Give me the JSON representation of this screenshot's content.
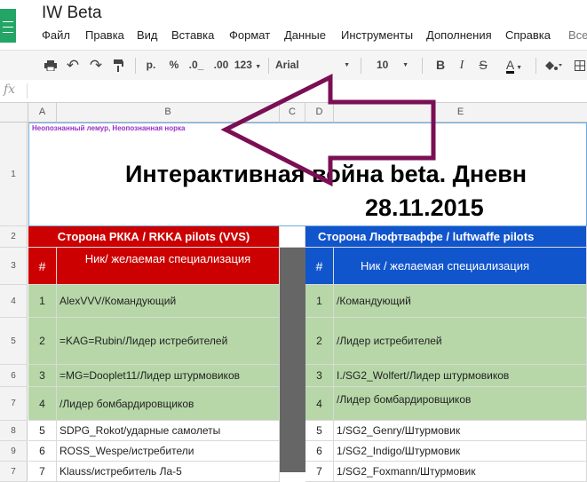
{
  "app": {
    "title": "IW Beta"
  },
  "menu": [
    "Файл",
    "Правка",
    "Вид",
    "Вставка",
    "Формат",
    "Данные",
    "Инструменты",
    "Дополнения",
    "Справка",
    "Все"
  ],
  "toolbar": {
    "currency": "р.",
    "percent": "%",
    "dec_less": ".0_",
    "dec_more": ".00",
    "more_formats": "123",
    "font": "Arial",
    "size": "10",
    "bold": "B",
    "italic": "I",
    "strike": "S",
    "text_color": "A"
  },
  "formula": {
    "fx_label": "fx",
    "value": ""
  },
  "columns": [
    "A",
    "B",
    "C",
    "D",
    "E"
  ],
  "rows": [
    "1",
    "2",
    "3",
    "4",
    "5",
    "6",
    "7",
    "8",
    "9"
  ],
  "sheet": {
    "note": "Неопознанный лемур, Неопознанная норка",
    "title_line1": "Интерактивная война beta. Дневн",
    "title_line2": "28.11.2015",
    "red_side": "Сторона РККА / RKKA pilots (VVS)",
    "blue_side": "Сторона Люфтваффе / luftwaffe pilots",
    "hash": "#",
    "red_header": "Ник/ желаемая специализация",
    "blue_header": "Ник / желаемая специализация",
    "red_rows": [
      {
        "n": "1",
        "v": "AlexVVV/Командующий"
      },
      {
        "n": "2",
        "v": " =KAG=Rubin/Лидер истребителей"
      },
      {
        "n": "3",
        "v": " =MG=Dooplet11/Лидер штурмовиков"
      },
      {
        "n": "4",
        "v": "/Лидер бомбардировщиков"
      },
      {
        "n": "5",
        "v": "SDPG_Rokot/ударные самолеты"
      },
      {
        "n": "6",
        "v": "ROSS_Wespe/истребители"
      },
      {
        "n": "7",
        "v": "Klauss/истребитель Ла-5"
      }
    ],
    "blue_rows": [
      {
        "n": "1",
        "v": "/Командующий"
      },
      {
        "n": "2",
        "v": "/Лидер истребителей"
      },
      {
        "n": "3",
        "v": "I./SG2_Wolfert/Лидер штурмовиков"
      },
      {
        "n": "4",
        "v": "/Лидер бомбардировщиков"
      },
      {
        "n": "5",
        "v": "1/SG2_Genry/Штурмовик"
      },
      {
        "n": "6",
        "v": "1/SG2_Indigo/Штурмовик"
      },
      {
        "n": "7",
        "v": "1/SG2_Foxmann/Штурмовик"
      }
    ]
  },
  "colors": {
    "red": "#cc0000",
    "blue": "#1155cc",
    "green": "#b7d7a8",
    "arrow": "#7b0f54",
    "note": "#9b30c8"
  }
}
